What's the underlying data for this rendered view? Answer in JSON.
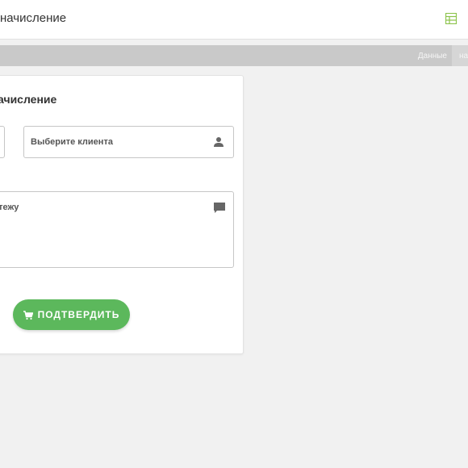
{
  "header": {
    "title": "начисление",
    "layout_icon": "table-layout-icon",
    "accent_color": "#8bc34a"
  },
  "subbar": {
    "crumb": "Данные",
    "tab": "на"
  },
  "card": {
    "title": "ачисление",
    "client_field": {
      "placeholder": "Выберите клиента",
      "icon": "person-icon"
    },
    "comment_field": {
      "label": "атежу",
      "icon": "comment-icon"
    },
    "confirm_button": {
      "label": "ПОДТВЕРДИТЬ",
      "icon": "cart-icon",
      "color": "#5cb85c"
    }
  }
}
